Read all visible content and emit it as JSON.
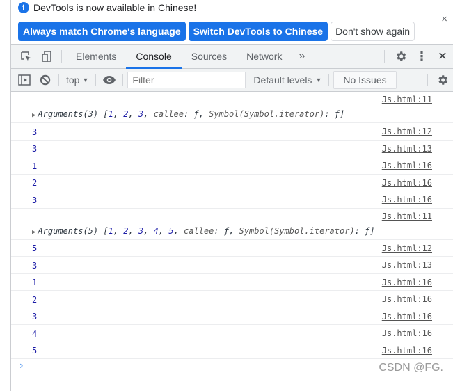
{
  "infobar": {
    "message": "DevTools is now available in Chinese!",
    "info_icon": "info-icon",
    "buttons": {
      "always_match": "Always match Chrome's language",
      "switch_chinese": "Switch DevTools to Chinese",
      "dont_show": "Don't show again"
    },
    "close_glyph": "×"
  },
  "tabbar": {
    "tabs": [
      {
        "label": "Elements",
        "active": false
      },
      {
        "label": "Console",
        "active": true
      },
      {
        "label": "Sources",
        "active": false
      },
      {
        "label": "Network",
        "active": false
      }
    ],
    "more_glyph": "»",
    "menu_glyph": "⋮",
    "close_glyph": "✕"
  },
  "console_toolbar": {
    "context": "top",
    "filter_placeholder": "Filter",
    "levels": "Default levels",
    "issues": "No Issues",
    "caret": "▼"
  },
  "messages": [
    {
      "type": "object",
      "source": "Js.html:11",
      "label": "Arguments(3)",
      "items": [
        "1",
        "2",
        "3"
      ],
      "callee_key": "callee",
      "fn": "ƒ",
      "symbol": "Symbol(Symbol.iterator)"
    },
    {
      "type": "number",
      "value": "3",
      "source": "Js.html:12"
    },
    {
      "type": "number",
      "value": "3",
      "source": "Js.html:13"
    },
    {
      "type": "number",
      "value": "1",
      "source": "Js.html:16"
    },
    {
      "type": "number",
      "value": "2",
      "source": "Js.html:16"
    },
    {
      "type": "number",
      "value": "3",
      "source": "Js.html:16"
    },
    {
      "type": "object",
      "source": "Js.html:11",
      "label": "Arguments(5)",
      "items": [
        "1",
        "2",
        "3",
        "4",
        "5"
      ],
      "callee_key": "callee",
      "fn": "ƒ",
      "symbol": "Symbol(Symbol.iterator)"
    },
    {
      "type": "number",
      "value": "5",
      "source": "Js.html:12"
    },
    {
      "type": "number",
      "value": "3",
      "source": "Js.html:13"
    },
    {
      "type": "number",
      "value": "1",
      "source": "Js.html:16"
    },
    {
      "type": "number",
      "value": "2",
      "source": "Js.html:16"
    },
    {
      "type": "number",
      "value": "3",
      "source": "Js.html:16"
    },
    {
      "type": "number",
      "value": "4",
      "source": "Js.html:16"
    },
    {
      "type": "number",
      "value": "5",
      "source": "Js.html:16"
    }
  ],
  "prompt": {
    "glyph": "›"
  },
  "watermark": "CSDN @FG.",
  "colors": {
    "accent": "#1a73e8",
    "number": "#1a1aa6",
    "toolbar_bg": "#f1f3f4"
  }
}
